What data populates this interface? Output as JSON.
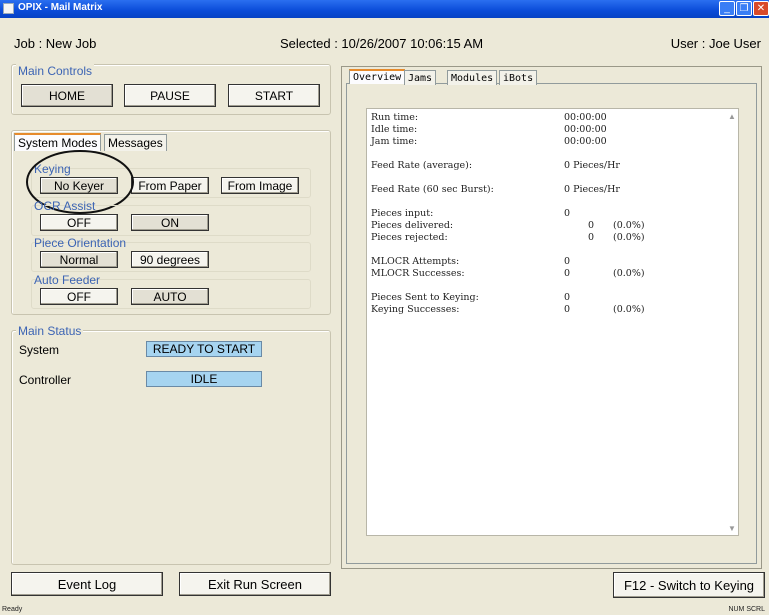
{
  "window": {
    "title": "OPIX - Mail Matrix"
  },
  "header": {
    "job": "Job : New Job",
    "selected": "Selected : 10/26/2007 10:06:15 AM",
    "user": "User : Joe User"
  },
  "main_controls": {
    "title": "Main Controls",
    "home": "HOME",
    "pause": "PAUSE",
    "start": "START"
  },
  "tabs_left": [
    "System Modes",
    "Messages"
  ],
  "system_modes": {
    "keying": {
      "label": "Keying",
      "options": [
        "No Keyer",
        "From Paper",
        "From Image"
      ]
    },
    "ocr_assist": {
      "label": "OCR Assist",
      "options": [
        "OFF",
        "ON"
      ]
    },
    "piece_orientation": {
      "label": "Piece Orientation",
      "options": [
        "Normal",
        "90 degrees"
      ]
    },
    "auto_feeder": {
      "label": "Auto Feeder",
      "options": [
        "OFF",
        "AUTO"
      ]
    }
  },
  "main_status": {
    "title": "Main Status",
    "system_label": "System",
    "system_value": "READY TO START",
    "controller_label": "Controller",
    "controller_value": "IDLE"
  },
  "tabs_right": [
    "Overview",
    "Jams",
    "Modules",
    "iBots"
  ],
  "overview": {
    "rows": [
      {
        "label": "Run time:",
        "value": "00:00:00",
        "pct": ""
      },
      {
        "label": "Idle time:",
        "value": "00:00:00",
        "pct": ""
      },
      {
        "label": "Jam time:",
        "value": "00:00:00",
        "pct": ""
      },
      {
        "label": "Feed Rate (average):",
        "value": "0 Pieces/Hr",
        "pct": ""
      },
      {
        "label": "Feed Rate (60 sec Burst):",
        "value": "0 Pieces/Hr",
        "pct": ""
      },
      {
        "label": "Pieces input:",
        "value": "0",
        "pct": ""
      },
      {
        "label": "Pieces delivered:",
        "value": "0",
        "pct": "(0.0%)"
      },
      {
        "label": "Pieces rejected:",
        "value": "0",
        "pct": "(0.0%)"
      },
      {
        "label": "MLOCR Attempts:",
        "value": "0",
        "pct": ""
      },
      {
        "label": "MLOCR Successes:",
        "value": "0",
        "pct": "(0.0%)"
      },
      {
        "label": "Pieces Sent to Keying:",
        "value": "0",
        "pct": ""
      },
      {
        "label": "Keying Successes:",
        "value": "0",
        "pct": "(0.0%)"
      }
    ]
  },
  "footer": {
    "event_log": "Event Log",
    "exit_run_screen": "Exit Run Screen",
    "switch_keying": "F12 - Switch to Keying"
  },
  "statusbar": {
    "left": "Ready",
    "right": "NUM  SCRL"
  }
}
